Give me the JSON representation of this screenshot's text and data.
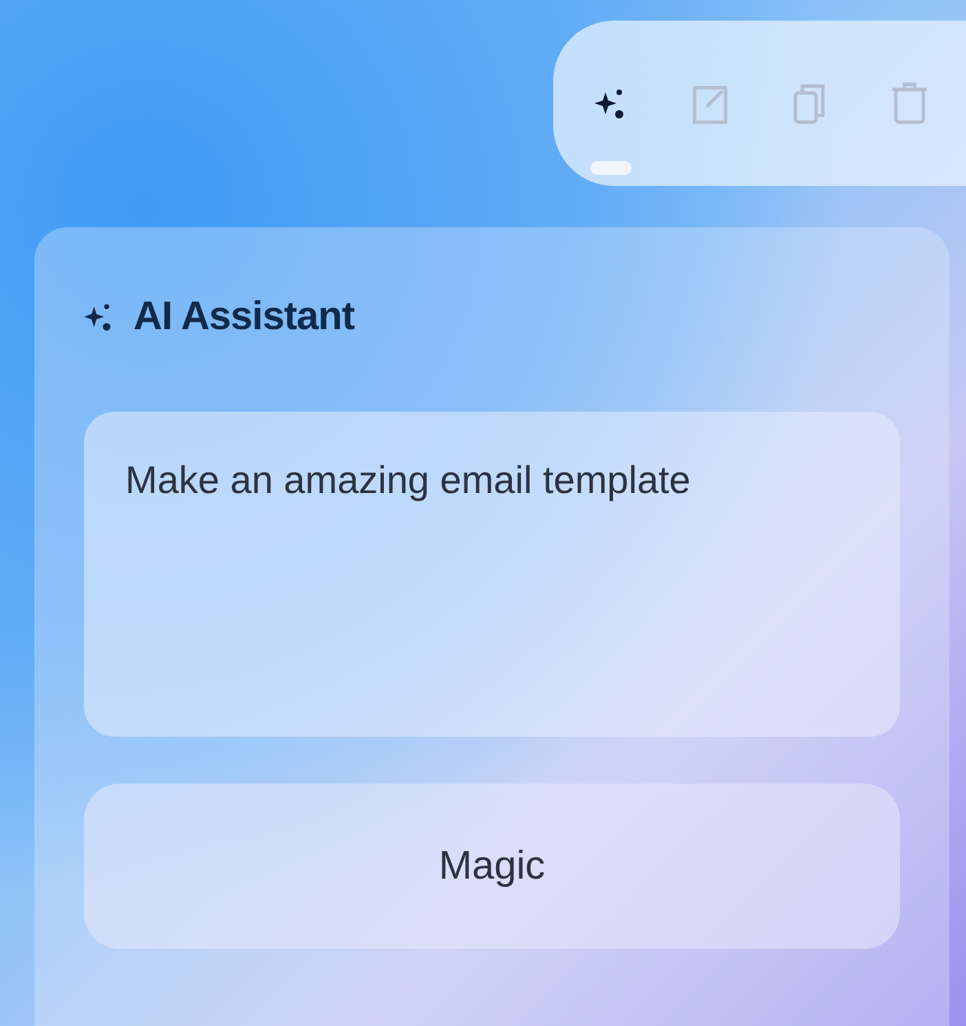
{
  "toolbar": {
    "items": [
      {
        "kind": "sparkle",
        "selected": true
      },
      {
        "kind": "edit",
        "selected": false
      },
      {
        "kind": "copy",
        "selected": false
      },
      {
        "kind": "trash",
        "selected": false
      }
    ]
  },
  "panel": {
    "title": "AI Assistant",
    "prompt": {
      "value": "Make an amazing email template"
    },
    "button": "Magic"
  }
}
